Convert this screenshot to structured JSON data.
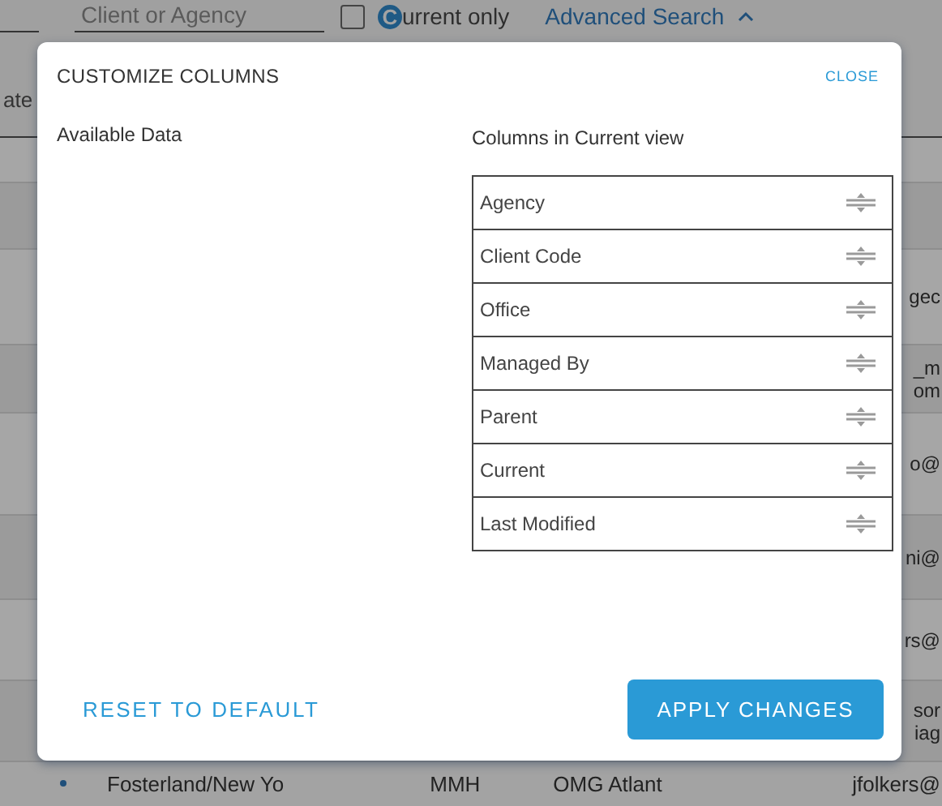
{
  "background": {
    "search_field": {
      "placeholder": "Client or Agency"
    },
    "current_only": {
      "checked": false,
      "icon_letter": "C",
      "label": "urrent only"
    },
    "advanced_search": {
      "label": "Advanced Search",
      "expanded": true
    },
    "column_header": "ate",
    "rows": [
      {
        "lines": []
      },
      {
        "lines": []
      },
      {
        "lines": [
          "gec"
        ]
      },
      {
        "lines": [
          "_m",
          "om"
        ]
      },
      {
        "lines": [
          "o@"
        ]
      },
      {
        "lines": [
          "ni@"
        ]
      },
      {
        "lines": [
          "rs@"
        ]
      },
      {
        "lines": [
          "sor",
          "iag"
        ]
      }
    ],
    "bottom_row": {
      "cells": [
        "Fosterland/New Yo",
        "MMH",
        "OMG Atlant"
      ],
      "email": "jfolkers@"
    }
  },
  "dialog": {
    "title": "CUSTOMIZE COLUMNS",
    "close": "CLOSE",
    "available_label": "Available Data",
    "current_label": "Columns in Current view",
    "columns": [
      "Agency",
      "Client Code",
      "Office",
      "Managed By",
      "Parent",
      "Current",
      "Last Modified"
    ],
    "reset": "RESET TO DEFAULT",
    "apply": "APPLY CHANGES"
  }
}
